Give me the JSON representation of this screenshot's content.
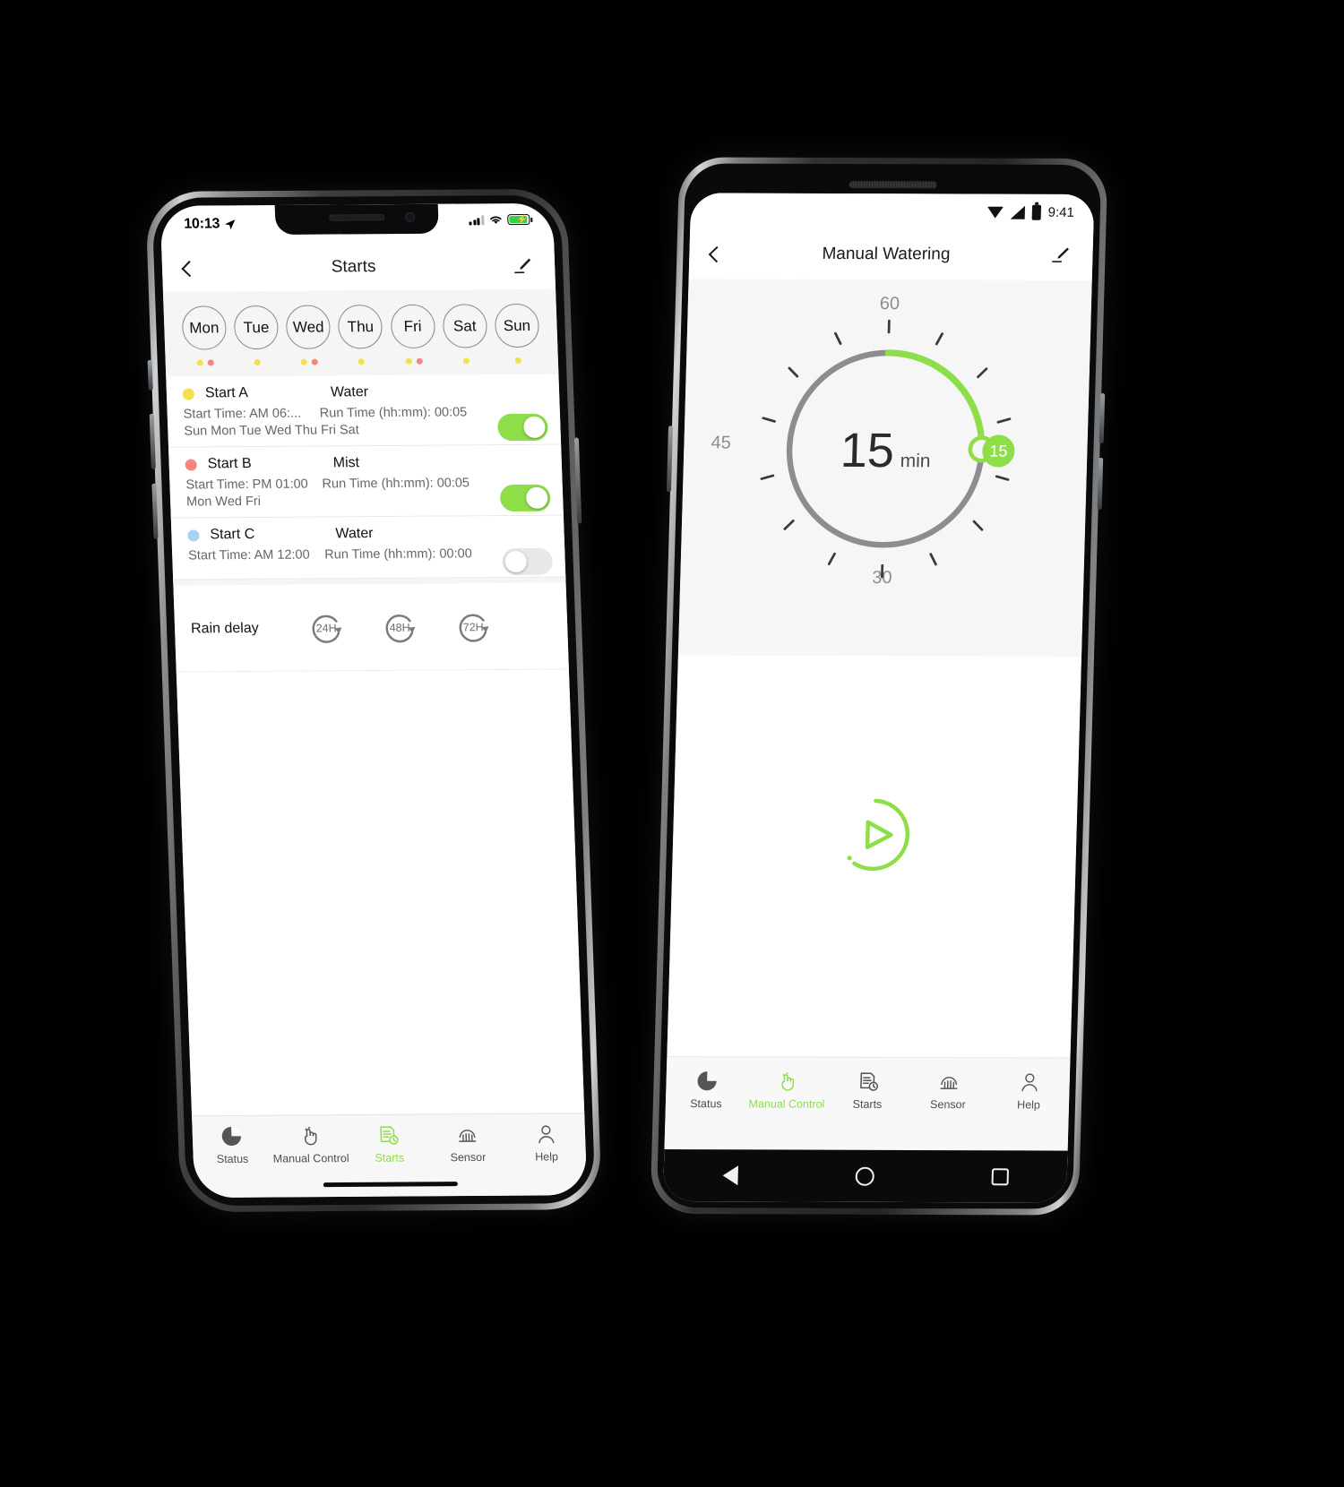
{
  "scene": {
    "background": "#000000",
    "accent": "#8ede4a"
  },
  "phone_left": {
    "platform": "iOS",
    "status_bar": {
      "time": "10:13",
      "location_icon": "location-arrow-icon",
      "signal_icon": "cellular-signal-icon",
      "wifi_icon": "wifi-icon",
      "battery_icon": "battery-charging-icon"
    },
    "navbar": {
      "back_icon": "chevron-left-icon",
      "title": "Starts",
      "edit_icon": "pencil-edit-icon"
    },
    "days": [
      {
        "label": "Mon",
        "dots": [
          "#f4e04d",
          "#f8867f"
        ]
      },
      {
        "label": "Tue",
        "dots": [
          "#f4e04d"
        ]
      },
      {
        "label": "Wed",
        "dots": [
          "#f4e04d",
          "#f8867f"
        ]
      },
      {
        "label": "Thu",
        "dots": [
          "#f4e04d"
        ]
      },
      {
        "label": "Fri",
        "dots": [
          "#f4e04d",
          "#f8867f"
        ]
      },
      {
        "label": "Sat",
        "dots": [
          "#f4e04d"
        ]
      },
      {
        "label": "Sun",
        "dots": [
          "#f4e04d"
        ]
      }
    ],
    "starts": [
      {
        "name": "Start A",
        "color": "#f4e04d",
        "type": "Water",
        "start_time": "Start Time: AM 06:...",
        "run_time": "Run Time (hh:mm): 00:05",
        "days": "Sun Mon Tue Wed Thu Fri Sat",
        "enabled": true
      },
      {
        "name": "Start B",
        "color": "#f8867f",
        "type": "Mist",
        "start_time": "Start Time: PM 01:00",
        "run_time": "Run Time (hh:mm): 00:05",
        "days": "Mon Wed Fri",
        "enabled": true
      },
      {
        "name": "Start C",
        "color": "#a8d3ef",
        "type": "Water",
        "start_time": "Start Time: AM 12:00",
        "run_time": "Run Time (hh:mm): 00:00",
        "days": "",
        "enabled": false
      }
    ],
    "rain_delay": {
      "label": "Rain delay",
      "options": [
        "24H",
        "48H",
        "72H"
      ]
    },
    "tabs": [
      {
        "label": "Status",
        "icon": "pie-chart-icon",
        "active": false
      },
      {
        "label": "Manual Control",
        "icon": "hand-tap-icon",
        "active": false
      },
      {
        "label": "Starts",
        "icon": "document-clock-icon",
        "active": true
      },
      {
        "label": "Sensor",
        "icon": "rain-sensor-icon",
        "active": false
      },
      {
        "label": "Help",
        "icon": "person-icon",
        "active": false
      }
    ]
  },
  "phone_right": {
    "platform": "Android",
    "status_bar": {
      "time": "9:41",
      "wifi_icon": "wifi-icon",
      "signal_icon": "cellular-signal-icon",
      "battery_icon": "battery-icon"
    },
    "navbar": {
      "back_icon": "chevron-left-icon",
      "title": "Manual Watering",
      "edit_icon": "pencil-edit-icon"
    },
    "dial": {
      "value": "15",
      "unit": "min",
      "handle_badge": "15",
      "tick_labels": {
        "top": "60",
        "left": "45",
        "bottom": "30"
      },
      "max": 60,
      "arc_color": "#8ede4a",
      "track_color": "#8d8d8d"
    },
    "play_button": {
      "icon": "play-circle-icon",
      "color": "#8ede4a"
    },
    "tabs": [
      {
        "label": "Status",
        "icon": "pie-chart-icon",
        "active": false
      },
      {
        "label": "Manual Control",
        "icon": "hand-tap-icon",
        "active": true
      },
      {
        "label": "Starts",
        "icon": "document-clock-icon",
        "active": false
      },
      {
        "label": "Sensor",
        "icon": "rain-sensor-icon",
        "active": false
      },
      {
        "label": "Help",
        "icon": "person-icon",
        "active": false
      }
    ],
    "system_nav": [
      {
        "icon": "android-back-icon"
      },
      {
        "icon": "android-home-icon"
      },
      {
        "icon": "android-recents-icon"
      }
    ]
  }
}
